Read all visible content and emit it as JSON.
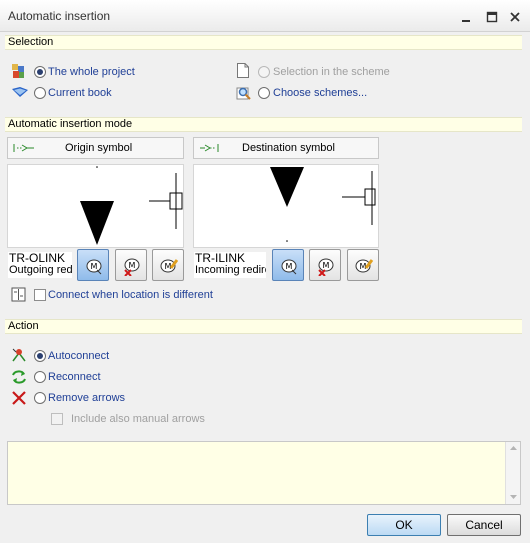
{
  "window": {
    "title": "Automatic insertion"
  },
  "selection": {
    "header": "Selection",
    "whole_project": "The whole project",
    "current_book": "Current book",
    "selection_in_scheme": "Selection in the scheme",
    "choose_schemes": "Choose schemes..."
  },
  "mode": {
    "header": "Automatic insertion mode",
    "origin": {
      "title": "Origin symbol",
      "name_line1": "TR-OLINK",
      "name_line2": "Outgoing red"
    },
    "destination": {
      "title": "Destination symbol",
      "name_line1": "TR-ILINK",
      "name_line2": "Incoming redire"
    },
    "connect_label": "Connect when location is different"
  },
  "action": {
    "header": "Action",
    "autoconnect": "Autoconnect",
    "reconnect": "Reconnect",
    "remove_arrows": "Remove arrows",
    "include_manual": "Include also manual arrows"
  },
  "footer": {
    "ok": "OK",
    "cancel": "Cancel"
  },
  "colors": {
    "section_bg": "#ffffe6",
    "link_text": "#1f3f96",
    "accent": "#3c7fb1"
  }
}
